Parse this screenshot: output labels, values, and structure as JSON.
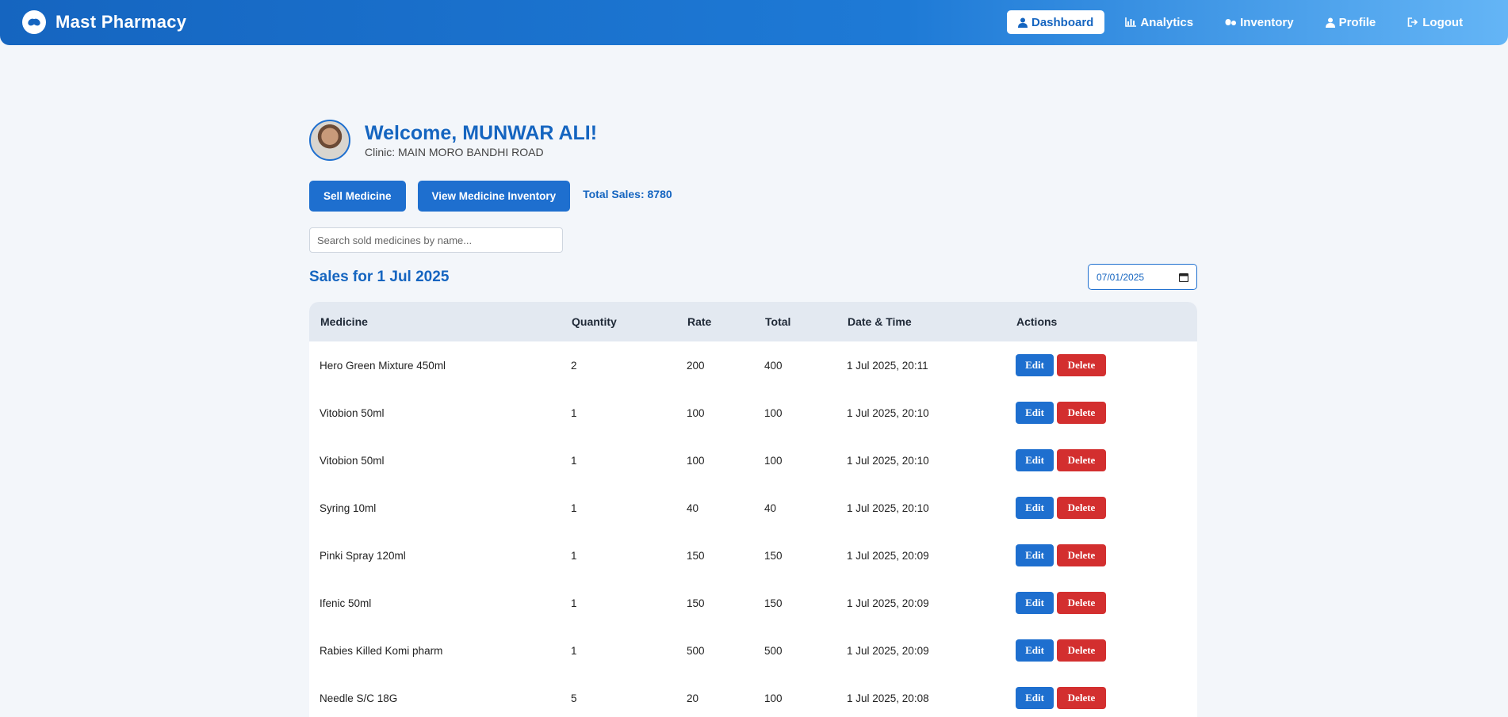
{
  "navbar": {
    "brand": "Mast Pharmacy",
    "links": [
      {
        "label": "Dashboard",
        "icon": "user-icon",
        "active": true
      },
      {
        "label": "Analytics",
        "icon": "chart-icon",
        "active": false
      },
      {
        "label": "Inventory",
        "icon": "pills-icon",
        "active": false
      },
      {
        "label": "Profile",
        "icon": "user-icon",
        "active": false
      },
      {
        "label": "Logout",
        "icon": "logout-icon",
        "active": false
      }
    ]
  },
  "welcome": {
    "title": "Welcome, MUNWAR ALI!",
    "clinic": "Clinic: MAIN MORO BANDHI ROAD"
  },
  "actions": {
    "sell_label": "Sell Medicine",
    "inventory_label": "View Medicine Inventory",
    "total_sales": "Total Sales: 8780"
  },
  "search": {
    "placeholder": "Search sold medicines by name..."
  },
  "sales": {
    "title": "Sales for 1 Jul 2025",
    "date_value": "07/01/2025"
  },
  "table": {
    "headers": [
      "Medicine",
      "Quantity",
      "Rate",
      "Total",
      "Date & Time",
      "Actions"
    ],
    "edit_label": "Edit",
    "delete_label": "Delete",
    "rows": [
      {
        "medicine": "Hero Green Mixture 450ml",
        "quantity": "2",
        "rate": "200",
        "total": "400",
        "datetime": "1 Jul 2025, 20:11"
      },
      {
        "medicine": "Vitobion 50ml",
        "quantity": "1",
        "rate": "100",
        "total": "100",
        "datetime": "1 Jul 2025, 20:10"
      },
      {
        "medicine": "Vitobion 50ml",
        "quantity": "1",
        "rate": "100",
        "total": "100",
        "datetime": "1 Jul 2025, 20:10"
      },
      {
        "medicine": "Syring 10ml",
        "quantity": "1",
        "rate": "40",
        "total": "40",
        "datetime": "1 Jul 2025, 20:10"
      },
      {
        "medicine": "Pinki Spray 120ml",
        "quantity": "1",
        "rate": "150",
        "total": "150",
        "datetime": "1 Jul 2025, 20:09"
      },
      {
        "medicine": "Ifenic 50ml",
        "quantity": "1",
        "rate": "150",
        "total": "150",
        "datetime": "1 Jul 2025, 20:09"
      },
      {
        "medicine": "Rabies Killed Komi pharm",
        "quantity": "1",
        "rate": "500",
        "total": "500",
        "datetime": "1 Jul 2025, 20:09"
      },
      {
        "medicine": "Needle S/C 18G",
        "quantity": "5",
        "rate": "20",
        "total": "100",
        "datetime": "1 Jul 2025, 20:08"
      }
    ]
  },
  "colors": {
    "primary": "#1e6fcf",
    "danger": "#d32f2f",
    "brand_dark": "#1565c0"
  }
}
